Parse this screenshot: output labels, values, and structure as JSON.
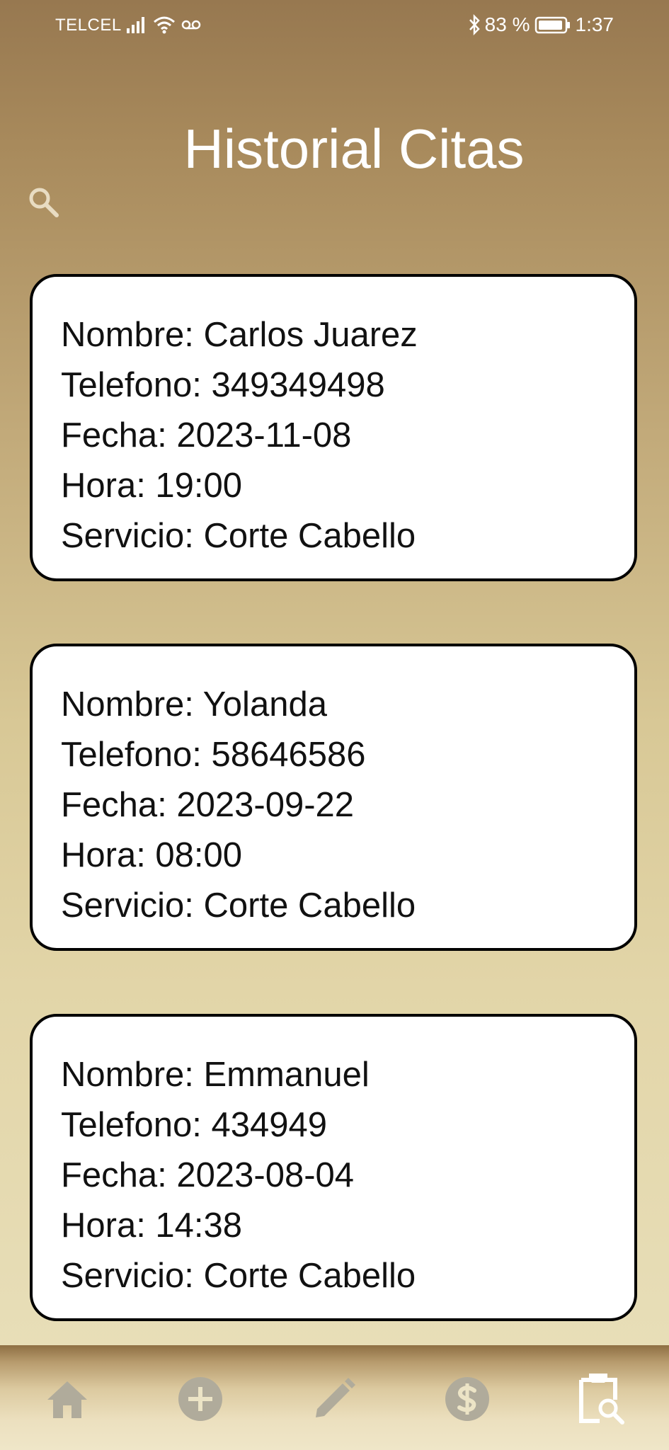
{
  "status_bar": {
    "carrier": "TELCEL",
    "battery": "83 %",
    "time": "1:37"
  },
  "header": {
    "title": "Historial Citas"
  },
  "appointments": [
    {
      "nombre": "Nombre: Carlos Juarez",
      "telefono": "Telefono: 349349498",
      "fecha": "Fecha: 2023-11-08",
      "hora": "Hora: 19:00",
      "servicio": "Servicio: Corte Cabello"
    },
    {
      "nombre": "Nombre: Yolanda",
      "telefono": "Telefono: 58646586",
      "fecha": "Fecha: 2023-09-22",
      "hora": "Hora: 08:00",
      "servicio": "Servicio: Corte Cabello"
    },
    {
      "nombre": "Nombre: Emmanuel",
      "telefono": "Telefono: 434949",
      "fecha": "Fecha: 2023-08-04",
      "hora": "Hora: 14:38",
      "servicio": "Servicio: Corte Cabello"
    }
  ],
  "nav": {
    "items": [
      "home-icon",
      "add-circle-icon",
      "pencil-icon",
      "dollar-icon",
      "clipboard-search-icon"
    ],
    "active": "clipboard-search-icon",
    "inactive_color": "#b0ab9b",
    "active_color": "#ffffff"
  }
}
